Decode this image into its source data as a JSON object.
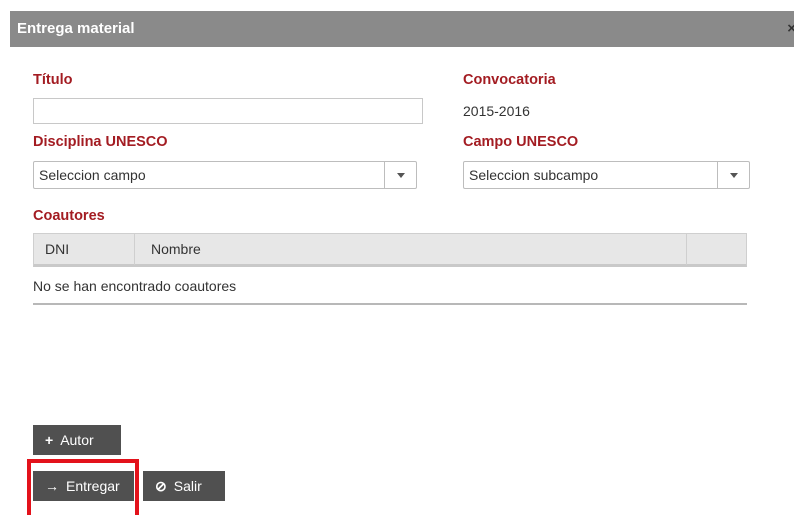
{
  "dialog": {
    "title": "Entrega material",
    "close_glyph": "×"
  },
  "form": {
    "titulo_label": "Título",
    "titulo_value": "",
    "convocatoria_label": "Convocatoria",
    "convocatoria_value": "2015-2016",
    "disciplina_label": "Disciplina UNESCO",
    "disciplina_selected": "Seleccion campo",
    "campo_label": "Campo UNESCO",
    "campo_selected": "Seleccion subcampo"
  },
  "coautores": {
    "label": "Coautores",
    "columns": [
      "DNI",
      "Nombre",
      ""
    ],
    "empty_message": "No se han encontrado coautores"
  },
  "buttons": {
    "autor_icon": "+",
    "autor_label": "Autor",
    "entregar_icon": "→",
    "entregar_label": "Entregar",
    "salir_icon": "⊘",
    "salir_label": "Salir"
  },
  "colors": {
    "label_red": "#a31c22",
    "title_bar": "#8a8a8a",
    "button_bg": "#505050",
    "highlight": "#e3121b"
  }
}
